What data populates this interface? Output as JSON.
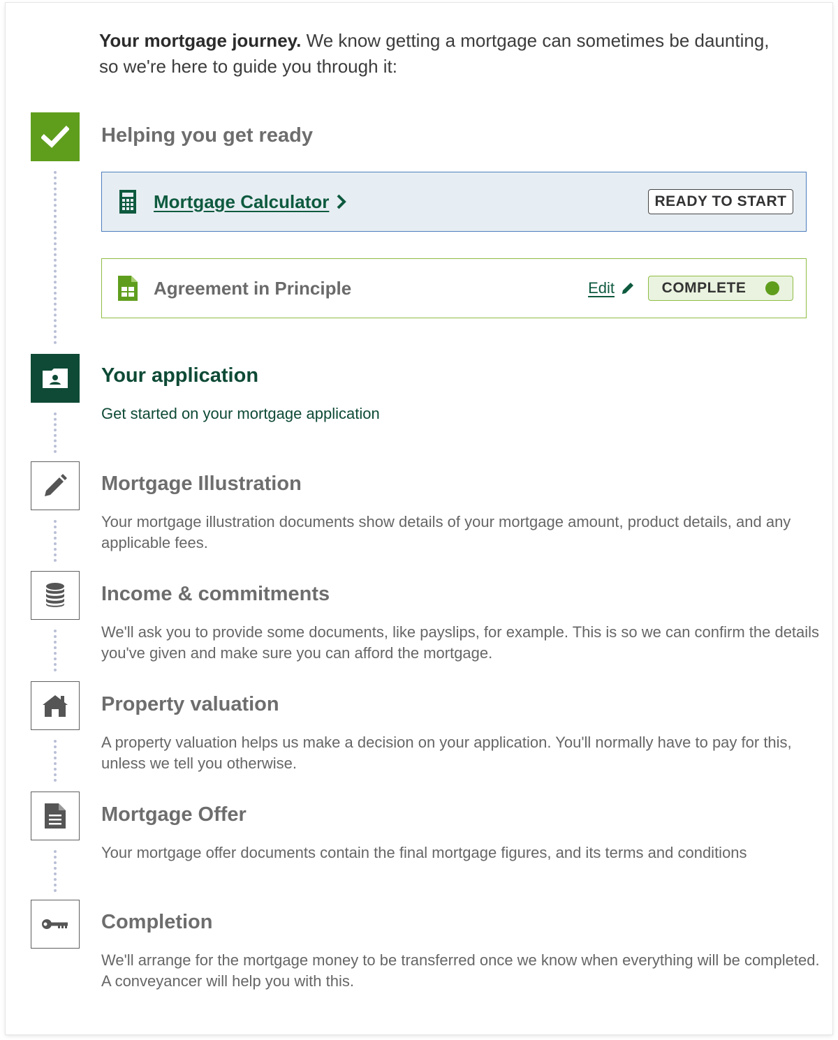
{
  "intro": {
    "bold": "Your mortgage journey.",
    "text": " We know getting a mortgage can sometimes be daunting, so we're here to guide you through it:"
  },
  "colors": {
    "complete_green": "#5f9e1d",
    "active_dark_green": "#0e4a35",
    "calc_card_bg": "#e7eef3",
    "calc_card_border": "#4d7dbd",
    "aip_card_border": "#8fbd45"
  },
  "steps": {
    "getting_ready": {
      "title": "Helping you get ready",
      "icon": "checkmark-icon",
      "state": "complete",
      "tasks": {
        "calculator": {
          "label": "Mortgage Calculator",
          "icon": "calculator-icon",
          "status": "READY TO START"
        },
        "aip": {
          "label": "Agreement in Principle",
          "icon": "spreadsheet-icon",
          "edit_label": "Edit",
          "status": "COMPLETE"
        }
      }
    },
    "application": {
      "title": "Your application",
      "icon": "id-card-folder-icon",
      "state": "active",
      "description": "Get started on your mortgage application"
    },
    "illustration": {
      "title": "Mortgage Illustration",
      "icon": "pencil-icon",
      "description": "Your mortgage illustration documents show details of your mortgage amount, product details, and any applicable fees."
    },
    "income": {
      "title": "Income & commitments",
      "icon": "coin-stack-icon",
      "description": "We'll ask you to provide some documents, like payslips, for example. This is so we can confirm the details you've given and make sure you can afford the mortgage."
    },
    "valuation": {
      "title": "Property valuation",
      "icon": "house-icon",
      "description": "A property valuation helps us make a decision on your application. You'll normally have to pay for this, unless we tell you otherwise."
    },
    "offer": {
      "title": "Mortgage Offer",
      "icon": "document-icon",
      "description": "Your mortgage offer documents contain the final mortgage figures, and its terms and conditions"
    },
    "completion": {
      "title": "Completion",
      "icon": "key-icon",
      "description": "We'll arrange for the mortgage money to be transferred once we know when everything will be completed. A conveyancer will help you with this."
    }
  }
}
